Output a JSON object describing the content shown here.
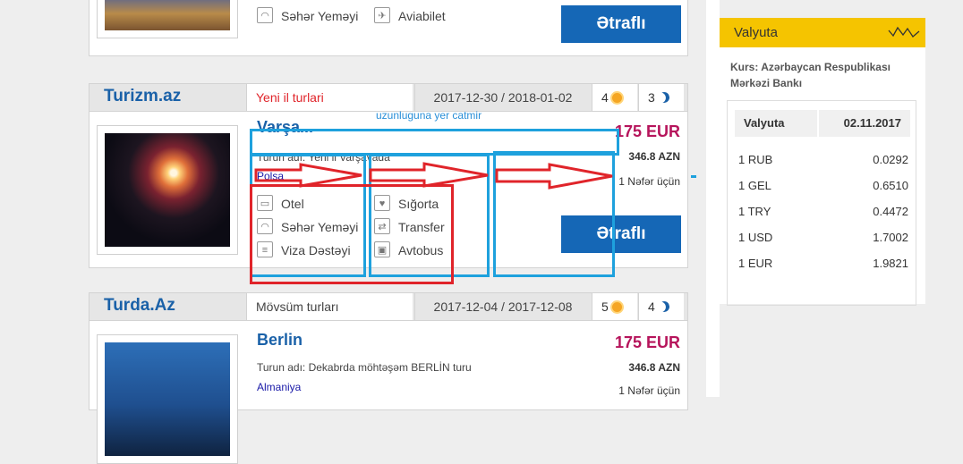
{
  "card_top": {
    "features": [
      {
        "label": "Səhər Yeməyi",
        "icon": "dish-icon"
      },
      {
        "label": "Aviabilet",
        "icon": "plane-icon"
      }
    ],
    "button": "Ətraflı"
  },
  "card1": {
    "agency": "Turizm.az",
    "category": "Yeni il turlari",
    "dates": "2017-12-30 / 2018-01-02",
    "days": "4",
    "nights": "3",
    "title": "Varşa...",
    "tour_name": "Turun adı: Yeni il Varşavada",
    "country": "Polşa",
    "price_eur": "175 EUR",
    "price_azn": "346.8 AZN",
    "per_person": "1 Nəfər üçün",
    "features_left": [
      "Otel",
      "Səhər Yeməyi",
      "Viza Dəstəyi"
    ],
    "features_right": [
      "Sığorta",
      "Transfer",
      "Avtobus"
    ],
    "button": "Ətraflı"
  },
  "card2": {
    "agency": "Turda.Az",
    "category": "Mövsüm turları",
    "dates": "2017-12-04 / 2017-12-08",
    "days": "5",
    "nights": "4",
    "title": "Berlin",
    "tour_name": "Turun adı: Dekabrda möhtəşəm BERLİN turu",
    "country": "Almaniya",
    "price_eur": "175 EUR",
    "price_azn": "346.8 AZN",
    "per_person": "1 Nəfər üçün"
  },
  "currency": {
    "title": "Valyuta",
    "bank": "Kurs: Azərbaycan Respublikası Mərkəzi Bankı",
    "col1": "Valyuta",
    "date": "02.11.2017",
    "rows": [
      {
        "cur": "1 RUB",
        "val": "0.0292"
      },
      {
        "cur": "1 GEL",
        "val": "0.6510"
      },
      {
        "cur": "1 TRY",
        "val": "0.4472"
      },
      {
        "cur": "1 USD",
        "val": "1.7002"
      },
      {
        "cur": "1 EUR",
        "val": "1.9821"
      }
    ]
  },
  "annotation": {
    "note": "uzunluguna yer catmir",
    "colors": {
      "blue": "#1ea1dd",
      "red": "#e0242a"
    }
  }
}
